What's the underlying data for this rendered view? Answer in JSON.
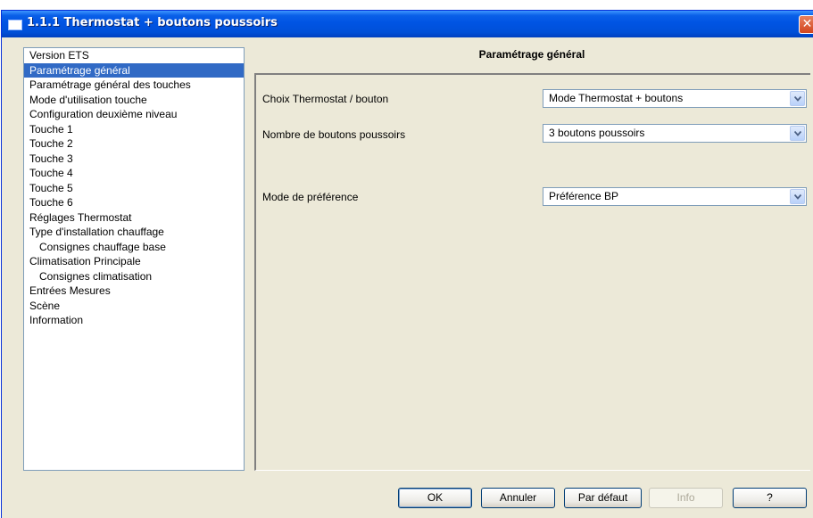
{
  "window": {
    "title": "1.1.1 Thermostat + boutons poussoirs",
    "close_label": "✕"
  },
  "tree": {
    "items": [
      {
        "label": "Version ETS",
        "selected": false,
        "indent": false
      },
      {
        "label": "Paramétrage général",
        "selected": true,
        "indent": false
      },
      {
        "label": "Paramétrage général des touches",
        "selected": false,
        "indent": false
      },
      {
        "label": "Mode d'utilisation touche",
        "selected": false,
        "indent": false
      },
      {
        "label": "Configuration deuxième niveau",
        "selected": false,
        "indent": false
      },
      {
        "label": "Touche 1",
        "selected": false,
        "indent": false
      },
      {
        "label": "Touche 2",
        "selected": false,
        "indent": false
      },
      {
        "label": "Touche 3",
        "selected": false,
        "indent": false
      },
      {
        "label": "Touche 4",
        "selected": false,
        "indent": false
      },
      {
        "label": "Touche 5",
        "selected": false,
        "indent": false
      },
      {
        "label": "Touche 6",
        "selected": false,
        "indent": false
      },
      {
        "label": "Réglages Thermostat",
        "selected": false,
        "indent": false
      },
      {
        "label": "Type d'installation chauffage",
        "selected": false,
        "indent": false
      },
      {
        "label": "Consignes chauffage base",
        "selected": false,
        "indent": true
      },
      {
        "label": "Climatisation Principale",
        "selected": false,
        "indent": false
      },
      {
        "label": "Consignes climatisation",
        "selected": false,
        "indent": true
      },
      {
        "label": "Entrées Mesures",
        "selected": false,
        "indent": false
      },
      {
        "label": "Scène",
        "selected": false,
        "indent": false
      },
      {
        "label": "Information",
        "selected": false,
        "indent": false
      }
    ]
  },
  "panel": {
    "title": "Paramétrage général",
    "fields": [
      {
        "label": "Choix Thermostat / bouton",
        "value": "Mode Thermostat + boutons"
      },
      {
        "label": "Nombre de boutons poussoirs",
        "value": "3 boutons poussoirs"
      },
      {
        "label": "Mode de préférence",
        "value": "Préférence BP"
      }
    ]
  },
  "buttons": {
    "ok": "OK",
    "cancel": "Annuler",
    "default": "Par défaut",
    "info": "Info",
    "help": "?"
  },
  "colors": {
    "titlebar": "#0054E3",
    "selection": "#316AC5",
    "dialog_bg": "#ECE9D8"
  }
}
